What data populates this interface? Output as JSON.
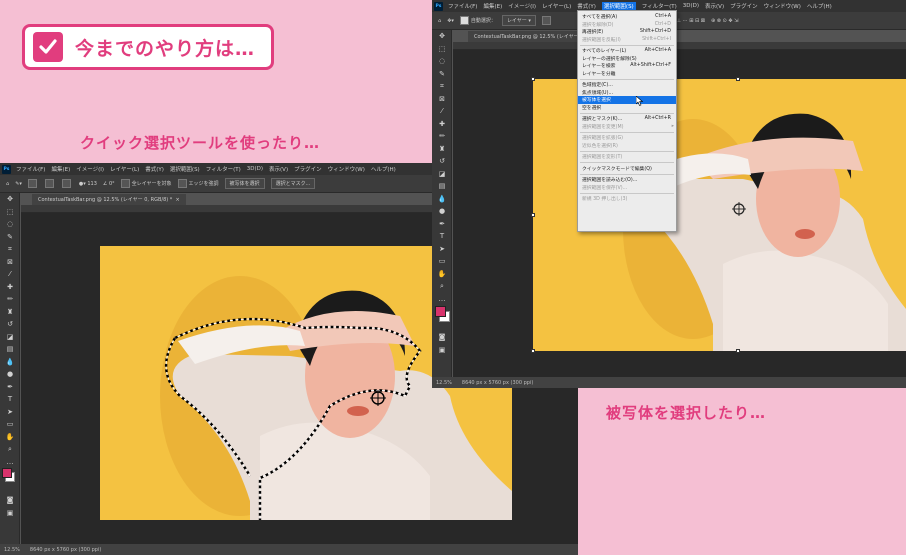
{
  "intro": {
    "badge_text": "今までのやり方は…",
    "caption_quick": "クイック選択ツールを使ったり…",
    "caption_subject": "被写体を選択したり…"
  },
  "colors": {
    "accent": "#e13d7e",
    "background": "#f5bfd3"
  },
  "window_left": {
    "menu": [
      "ファイル(F)",
      "編集(E)",
      "イメージ(I)",
      "レイヤー(L)",
      "書式(Y)",
      "選択範囲(S)",
      "フィルター(T)",
      "3D(D)",
      "表示(V)",
      "プラグイン",
      "ウィンドウ(W)",
      "ヘルプ(H)"
    ],
    "options": {
      "brush_size": "113",
      "angle": "0°",
      "sample_all": "全レイヤーを対象",
      "enhance_edge": "エッジを強調",
      "select_subject": "被写体を選択",
      "select_mask": "選択とマスク..."
    },
    "doc_tab": "ContextualTaskBar.png @ 12.5% (レイヤー 0, RGB/8) *",
    "status": {
      "zoom": "12.5%",
      "size": "8640 px x 5760 px (300 ppi)"
    }
  },
  "window_right": {
    "menu": [
      "ファイル(F)",
      "編集(E)",
      "イメージ(I)",
      "レイヤー(L)",
      "書式(Y)",
      "選択範囲(S)",
      "フィルター(T)",
      "3D(D)",
      "表示(V)",
      "プラグイン",
      "ウィンドウ(W)",
      "ヘルプ(H)"
    ],
    "options": {
      "auto_select": "自動選択：",
      "layer": "レイヤー"
    },
    "doc_tab": "ContextualTaskBar.png @ 12.5% (レイヤー",
    "status": {
      "zoom": "12.5%",
      "size": "8640 px x 5760 px (300 ppi)"
    }
  },
  "dropdown": {
    "items": [
      {
        "label": "すべてを選択(A)",
        "shortcut": "Ctrl+A"
      },
      {
        "label": "選択を解除(D)",
        "shortcut": "Ctrl+D"
      },
      {
        "label": "再選択(E)",
        "shortcut": "Shift+Ctrl+D"
      },
      {
        "label": "選択範囲を反転(I)",
        "shortcut": "Shift+Ctrl+I"
      },
      {
        "label": "すべてのレイヤー(L)",
        "shortcut": "Alt+Ctrl+A"
      },
      {
        "label": "レイヤーの選択を解除(S)",
        "shortcut": ""
      },
      {
        "label": "レイヤーを検索",
        "shortcut": "Alt+Shift+Ctrl+F"
      },
      {
        "label": "レイヤーを分離",
        "shortcut": ""
      },
      {
        "label": "色域指定(C)...",
        "shortcut": ""
      },
      {
        "label": "焦点領域(U)...",
        "shortcut": ""
      },
      {
        "label": "被写体を選択",
        "shortcut": ""
      },
      {
        "label": "空を選択",
        "shortcut": ""
      },
      {
        "label": "選択とマスク(K)...",
        "shortcut": "Alt+Ctrl+R"
      },
      {
        "label": "選択範囲を変更(M)",
        "shortcut": ""
      },
      {
        "label": "選択範囲を拡張(G)",
        "shortcut": ""
      },
      {
        "label": "近似色を選択(R)",
        "shortcut": ""
      },
      {
        "label": "選択範囲を変形(T)",
        "shortcut": ""
      },
      {
        "label": "クイックマスクモードで編集(Q)",
        "shortcut": ""
      },
      {
        "label": "選択範囲を読み込む(O)...",
        "shortcut": ""
      },
      {
        "label": "選択範囲を保存(V)...",
        "shortcut": ""
      },
      {
        "label": "新規 3D 押し出し(3)",
        "shortcut": ""
      }
    ]
  }
}
